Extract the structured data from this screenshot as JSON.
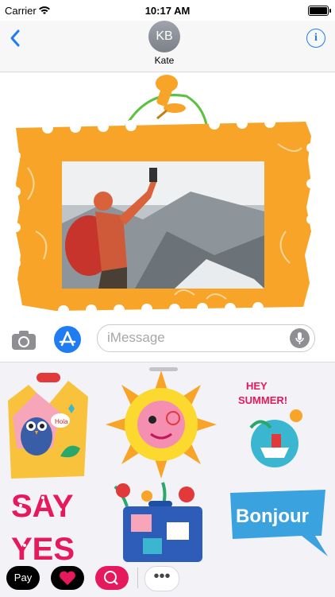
{
  "status_bar": {
    "carrier": "Carrier",
    "time": "10:17 AM",
    "icons": [
      "wifi-icon",
      "battery-icon"
    ]
  },
  "nav": {
    "avatar_initials": "KB",
    "contact_name": "Kate",
    "back_icon": "chevron-left-icon",
    "info_label": "i"
  },
  "message": {
    "sticker": "orange postage-stamp frame pinned with a thumbtack, containing a photo of a hiker in a red jacket on a snowy mountain"
  },
  "input": {
    "placeholder": "iMessage",
    "value": "",
    "camera_icon": "camera-icon",
    "app_store_icon": "app-store-icon",
    "mic_icon": "microphone-icon"
  },
  "stickers": {
    "items": [
      {
        "name": "sticker-hello-birds",
        "caption": "Hola"
      },
      {
        "name": "sticker-sun"
      },
      {
        "name": "sticker-hey-summer",
        "caption": "HEY SUMMER!"
      },
      {
        "name": "sticker-say-yes",
        "caption": "SAY YES"
      },
      {
        "name": "sticker-suitcase-flowers"
      },
      {
        "name": "sticker-bonjour",
        "caption": "Bonjour"
      }
    ]
  },
  "app_strip": {
    "pay_label": "Pay",
    "more_label": "•••",
    "icons": [
      "apple-pay-icon",
      "heart-app-icon",
      "globe-search-app-icon",
      "more-apps-icon"
    ]
  },
  "colors": {
    "accent": "#1f7cf3",
    "stamp": "#f7a428",
    "globe_app": "#e5195b"
  }
}
